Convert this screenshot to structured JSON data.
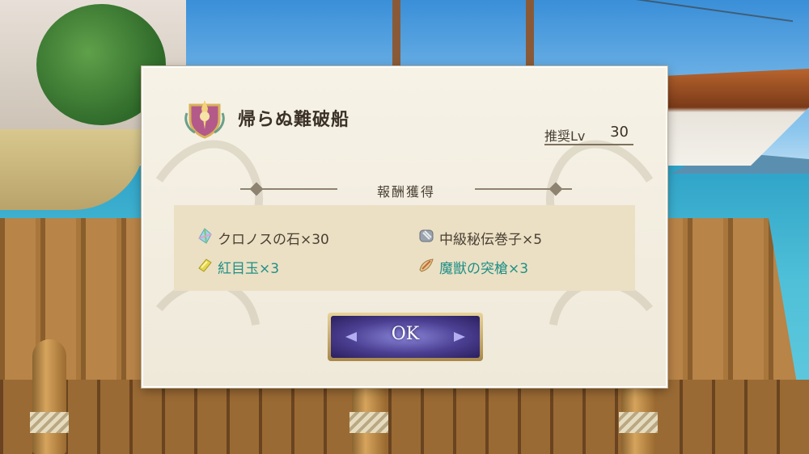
{
  "stage": {
    "title": "帰らぬ難破船",
    "recommended_level_label": "推奨Lv",
    "recommended_level_value": "30"
  },
  "rewards": {
    "header": "報酬獲得",
    "items": [
      {
        "name": "クロノスの石×30",
        "icon": "chronos-stone-icon",
        "style": "normal"
      },
      {
        "name": "中級秘伝巻子×5",
        "icon": "scroll-icon",
        "style": "normal"
      },
      {
        "name": "紅目玉×3",
        "icon": "red-eye-gem-icon",
        "style": "teal"
      },
      {
        "name": "魔獣の突槍×3",
        "icon": "beast-spear-icon",
        "style": "teal"
      }
    ]
  },
  "ok_button": {
    "label": "OK"
  },
  "colors": {
    "panel_bg": "#f3eee0",
    "reward_box_bg": "#ebe0c4",
    "teal_text": "#1f8f86",
    "button_purple": "#4b3f92"
  }
}
